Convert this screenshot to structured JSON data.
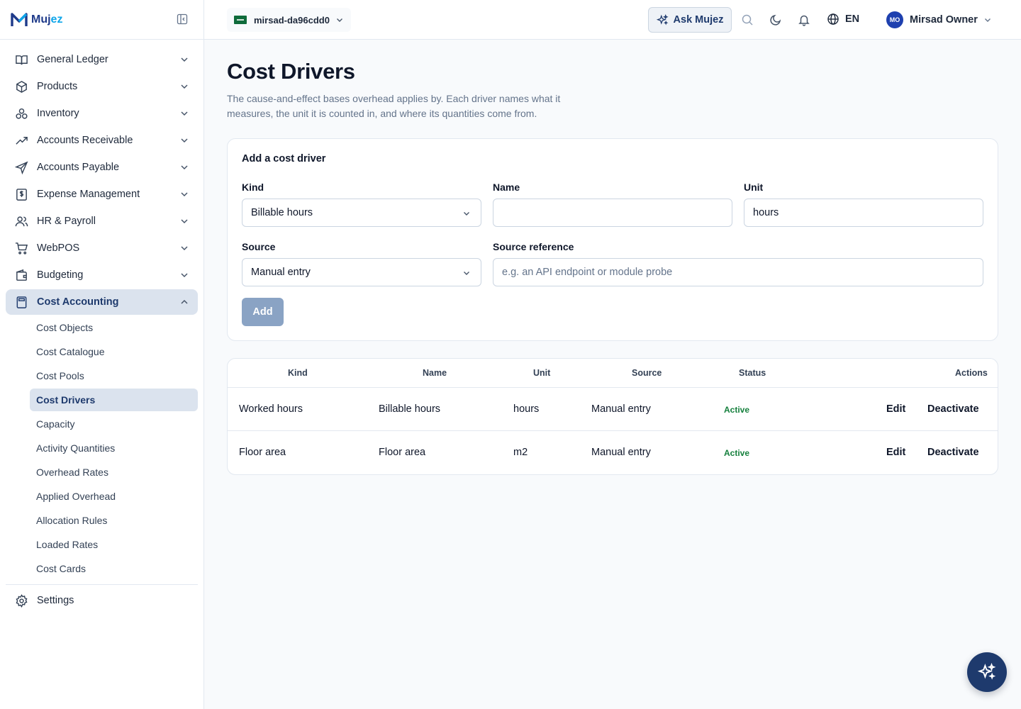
{
  "brand": {
    "name_main": "Muj",
    "name_accent": "ez"
  },
  "sidebar": {
    "items": [
      {
        "label": "General Ledger",
        "icon": "book-open-icon"
      },
      {
        "label": "Products",
        "icon": "package-icon"
      },
      {
        "label": "Inventory",
        "icon": "boxes-icon"
      },
      {
        "label": "Accounts Receivable",
        "icon": "trending-up-icon"
      },
      {
        "label": "Accounts Payable",
        "icon": "send-icon"
      },
      {
        "label": "Expense Management",
        "icon": "receipt-dollar-icon"
      },
      {
        "label": "HR & Payroll",
        "icon": "users-icon"
      },
      {
        "label": "WebPOS",
        "icon": "shopping-cart-icon"
      },
      {
        "label": "Budgeting",
        "icon": "wallet-icon"
      },
      {
        "label": "Cost Accounting",
        "icon": "calculator-icon"
      }
    ],
    "sub_items": [
      "Cost Objects",
      "Cost Catalogue",
      "Cost Pools",
      "Cost Drivers",
      "Capacity",
      "Activity Quantities",
      "Overhead Rates",
      "Applied Overhead",
      "Allocation Rules",
      "Loaded Rates",
      "Cost Cards"
    ],
    "settings": "Settings"
  },
  "header": {
    "org": "mirsad-da96cdd0",
    "ask": "Ask Mujez",
    "lang": "EN",
    "avatar_initials": "MO",
    "user": "Mirsad Owner"
  },
  "page": {
    "title": "Cost Drivers",
    "description": "The cause-and-effect bases overhead applies by. Each driver names what it measures, the unit it is counted in, and where its quantities come from."
  },
  "form": {
    "title": "Add a cost driver",
    "kind_label": "Kind",
    "kind_value": "Billable hours",
    "name_label": "Name",
    "name_value": "",
    "unit_label": "Unit",
    "unit_value": "hours",
    "source_label": "Source",
    "source_value": "Manual entry",
    "source_ref_label": "Source reference",
    "source_ref_placeholder": "e.g. an API endpoint or module probe",
    "add_label": "Add"
  },
  "table": {
    "headers": {
      "kind": "Kind",
      "name": "Name",
      "unit": "Unit",
      "source": "Source",
      "status": "Status",
      "actions": "Actions"
    },
    "rows": [
      {
        "kind": "Worked hours",
        "name": "Billable hours",
        "unit": "hours",
        "source": "Manual entry",
        "status": "Active",
        "edit": "Edit",
        "deactivate": "Deactivate"
      },
      {
        "kind": "Floor area",
        "name": "Floor area",
        "unit": "m2",
        "source": "Manual entry",
        "status": "Active",
        "edit": "Edit",
        "deactivate": "Deactivate"
      }
    ]
  },
  "colors": {
    "primary": "#1e3a6d",
    "active_bg": "#dbe3ee",
    "status_active": "#15803d",
    "add_button": "#8aa3c4"
  }
}
